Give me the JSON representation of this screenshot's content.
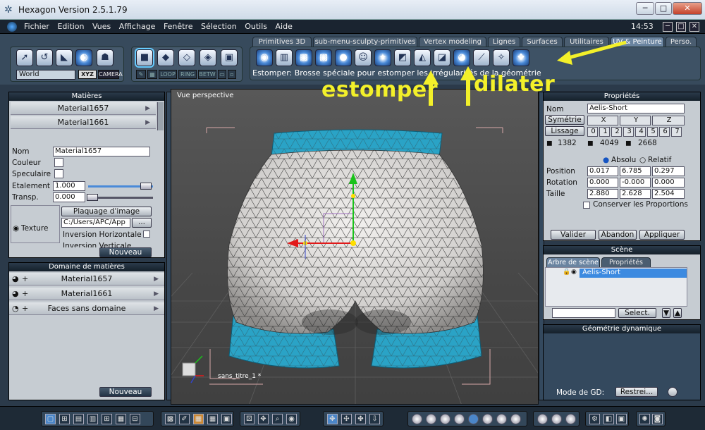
{
  "window": {
    "title": "Hexagon Version 2.5.1.79",
    "minimize": "─",
    "maximize": "□",
    "close": "✕"
  },
  "menubar": {
    "items": [
      "Fichier",
      "Edition",
      "Vues",
      "Affichage",
      "Fenêtre",
      "Sélection",
      "Outils",
      "Aide"
    ],
    "time": "14:53",
    "btn_min": "─",
    "btn_max": "□",
    "btn_close": "✕"
  },
  "toolbar": {
    "coord_select": "World",
    "xyz_label": "XYZ",
    "camera_label": "CAMERA",
    "sel_buttons": [
      "LOOP",
      "RING",
      "BETW"
    ],
    "tabs": [
      "Primitives 3D",
      "sub-menu-sculpty-primitives",
      "Vertex modeling",
      "Lignes",
      "Surfaces",
      "Utilitaires",
      "UV & Peinture",
      "Perso."
    ],
    "active_tab": "UV & Peinture",
    "hint": "Estomper: Brosse spéciale pour estomper les irrégularités de la géométrie"
  },
  "annotations": {
    "estomper": "estomper",
    "dilater": "dilater"
  },
  "materials_panel": {
    "title": "Matières",
    "materials": [
      "Material1657",
      "Material1661"
    ],
    "name_label": "Nom",
    "name_value": "Material1657",
    "color_label": "Couleur",
    "specular_label": "Speculaire",
    "spread_label": "Etalement",
    "spread_value": "1.000",
    "transp_label": "Transp.",
    "transp_value": "0.000",
    "texture_label": "Texture",
    "texture_mode": "Plaquage d'image",
    "texture_path": "C:/Users/APC/App",
    "browse": "...",
    "flip_h": "Inversion Horizontale",
    "flip_v": "Inversion Verticale",
    "new_btn": "Nouveau"
  },
  "domain_panel": {
    "title": "Domaine de matières",
    "items": [
      "Material1657",
      "Material1661",
      "Faces sans domaine"
    ],
    "new_btn": "Nouveau"
  },
  "viewport": {
    "label": "Vue perspective",
    "object_label": "sans_titre_1 *"
  },
  "properties_panel": {
    "title": "Propriétés",
    "name_label": "Nom",
    "name_value": "Aelis-Short",
    "symmetry_btn": "Symétrie",
    "axes": [
      "X",
      "Y",
      "Z"
    ],
    "smooth_btn": "Lissage",
    "levels": [
      "0",
      "1",
      "2",
      "3",
      "4",
      "5",
      "6",
      "7"
    ],
    "counts": [
      "1382",
      "4049",
      "2668"
    ],
    "abs_label": "Absolu",
    "rel_label": "Relatif",
    "position_label": "Position",
    "position": [
      "0.017",
      "6.785",
      "0.297"
    ],
    "rotation_label": "Rotation",
    "rotation": [
      "0.000",
      "-0.000",
      "0.000"
    ],
    "size_label": "Taille",
    "size": [
      "2.880",
      "2.628",
      "2.504"
    ],
    "keep_prop": "Conserver les Proportions",
    "validate": "Valider",
    "cancel": "Abandon",
    "apply": "Appliquer"
  },
  "scene_panel": {
    "title": "Scène",
    "tabs": [
      "Arbre de scène",
      "Propriétés"
    ],
    "item": "Aelis-Short",
    "select_btn": "Select."
  },
  "dyngeo_panel": {
    "title": "Géométrie dynamique",
    "mode_label": "Mode de GD:",
    "mode_value": "Restrei..."
  },
  "colors": {
    "mesh": "#e9e7e4",
    "cloth": "#2aa3c6",
    "annotation": "#f3f02a"
  }
}
